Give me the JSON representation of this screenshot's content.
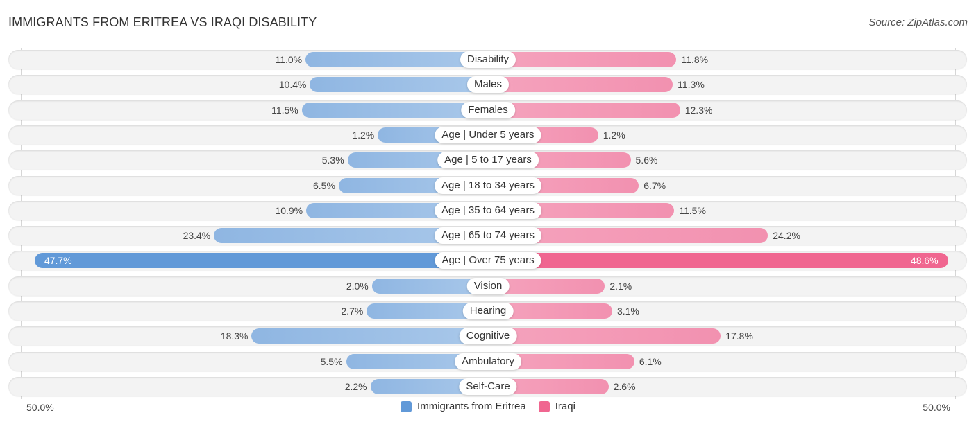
{
  "title": "IMMIGRANTS FROM ERITREA VS IRAQI DISABILITY",
  "source": "Source: ZipAtlas.com",
  "colors": {
    "left": "#6199d8",
    "right": "#f06690"
  },
  "chart_data": {
    "type": "bar",
    "orientation": "horizontal-diverging",
    "title": "IMMIGRANTS FROM ERITREA VS IRAQI DISABILITY",
    "categories": [
      "Disability",
      "Males",
      "Females",
      "Age | Under 5 years",
      "Age | 5 to 17 years",
      "Age | 18 to 34 years",
      "Age | 35 to 64 years",
      "Age | 65 to 74 years",
      "Age | Over 75 years",
      "Vision",
      "Hearing",
      "Cognitive",
      "Ambulatory",
      "Self-Care"
    ],
    "series": [
      {
        "name": "Immigrants from Eritrea",
        "side": "left",
        "values": [
          11.0,
          10.4,
          11.5,
          1.2,
          5.3,
          6.5,
          10.9,
          23.4,
          47.7,
          2.0,
          2.7,
          18.3,
          5.5,
          2.2
        ],
        "labels": [
          "11.0%",
          "10.4%",
          "11.5%",
          "1.2%",
          "5.3%",
          "6.5%",
          "10.9%",
          "23.4%",
          "47.7%",
          "2.0%",
          "2.7%",
          "18.3%",
          "5.5%",
          "2.2%"
        ]
      },
      {
        "name": "Iraqi",
        "side": "right",
        "values": [
          11.8,
          11.3,
          12.3,
          1.2,
          5.6,
          6.7,
          11.5,
          24.2,
          48.6,
          2.1,
          3.1,
          17.8,
          6.1,
          2.6
        ],
        "labels": [
          "11.8%",
          "11.3%",
          "12.3%",
          "1.2%",
          "5.6%",
          "6.7%",
          "11.5%",
          "24.2%",
          "48.6%",
          "2.1%",
          "3.1%",
          "17.8%",
          "6.1%",
          "2.6%"
        ]
      }
    ],
    "axis": {
      "left_label": "50.0%",
      "right_label": "50.0%",
      "max": 50.0
    },
    "legend": {
      "position": "bottom-center",
      "items": [
        "Immigrants from Eritrea",
        "Iraqi"
      ]
    }
  }
}
